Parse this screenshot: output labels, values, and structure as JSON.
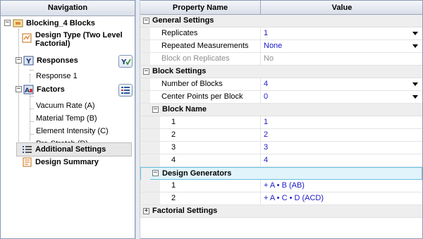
{
  "navigation": {
    "title": "Navigation",
    "root": {
      "label": "Blocking_4 Blocks",
      "icon": "folio-icon"
    },
    "design_type": {
      "label": "Design Type (Two Level Factorial)",
      "line1": "Design Type (Two Level",
      "line2": "Factorial)",
      "icon": "design-icon"
    },
    "responses": {
      "label": "Responses",
      "icon": "responses-icon",
      "button_icon": "edit-responses-icon",
      "items": [
        "Response 1"
      ]
    },
    "factors": {
      "label": "Factors",
      "icon": "factors-icon",
      "button_icon": "edit-factors-icon",
      "items": [
        "Vacuum Rate (A)",
        "Material Temp (B)",
        "Element Intensity (C)",
        "Pre-Stretch (D)"
      ]
    },
    "additional_settings": {
      "label": "Additional Settings",
      "icon": "list-icon",
      "selected": true
    },
    "design_summary": {
      "label": "Design Summary",
      "icon": "summary-icon"
    }
  },
  "grid": {
    "columns": {
      "name": "Property Name",
      "value": "Value"
    },
    "general": {
      "label": "General Settings",
      "replicates": {
        "name": "Replicates",
        "value": "1"
      },
      "repeated": {
        "name": "Repeated Measurements",
        "value": "None"
      },
      "block_on_rep": {
        "name": "Block on Replicates",
        "value": "No"
      }
    },
    "block": {
      "label": "Block Settings",
      "num_blocks": {
        "name": "Number of Blocks",
        "value": "4"
      },
      "center_points": {
        "name": "Center Points per Block",
        "value": "0"
      },
      "block_name": {
        "label": "Block Name",
        "rows": [
          {
            "name": "1",
            "value": "1"
          },
          {
            "name": "2",
            "value": "2"
          },
          {
            "name": "3",
            "value": "3"
          },
          {
            "name": "4",
            "value": "4"
          }
        ]
      },
      "generators": {
        "label": "Design Generators",
        "rows": [
          {
            "name": "1",
            "value": "+ A • B (AB)"
          },
          {
            "name": "2",
            "value": "+ A • C • D (ACD)"
          }
        ]
      }
    },
    "factorial": {
      "label": "Factorial Settings"
    }
  },
  "colors": {
    "link_blue": "#1a1ac8",
    "focus_border": "#67c1e3"
  }
}
